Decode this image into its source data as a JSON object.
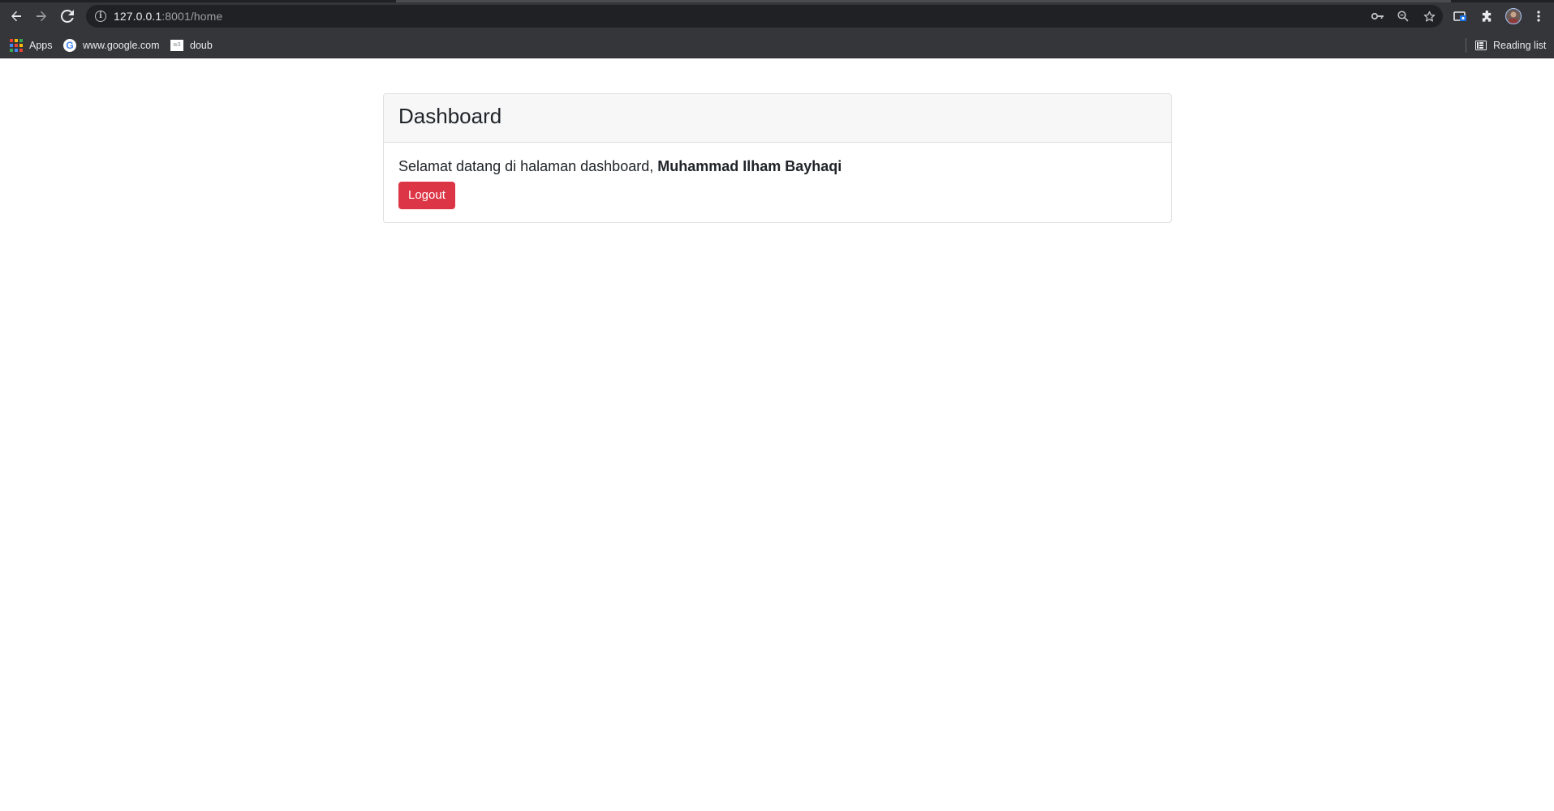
{
  "browser": {
    "url_host": "127.0.0.1",
    "url_path": ":8001/home",
    "bookmarks": [
      {
        "label": "Apps",
        "icon": "apps-grid-icon"
      },
      {
        "label": "www.google.com",
        "icon": "google-icon"
      },
      {
        "label": "doub",
        "icon": "doub-favicon-icon"
      }
    ],
    "reading_list_label": "Reading list",
    "doub_icon_text": "w3"
  },
  "dashboard": {
    "title": "Dashboard",
    "welcome_text": "Selamat datang di halaman dashboard, ",
    "user_name": "Muhammad Ilham Bayhaqi",
    "logout_label": "Logout"
  },
  "colors": {
    "chrome_bg": "#35363a",
    "omnibox_bg": "#202124",
    "card_header_bg": "#f7f7f7",
    "logout_button": "#dc3545"
  }
}
